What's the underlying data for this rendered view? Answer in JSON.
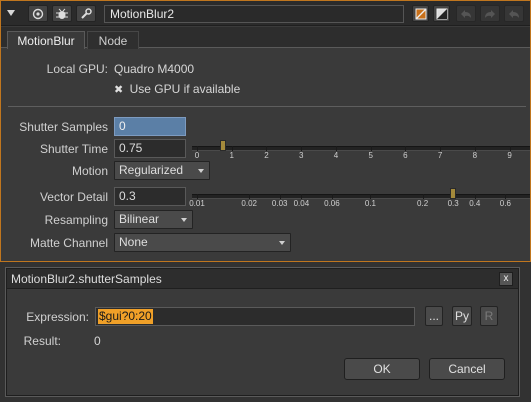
{
  "node": {
    "name": "MotionBlur2",
    "tabs": [
      {
        "label": "MotionBlur"
      },
      {
        "label": "Node"
      }
    ]
  },
  "properties": {
    "local_gpu_label": "Local GPU:",
    "local_gpu_value": "Quadro M4000",
    "use_gpu_checkbox": {
      "checked": true,
      "mark": "✖",
      "label": "Use GPU if available"
    },
    "shutter_samples": {
      "label": "Shutter Samples",
      "value": "0"
    },
    "shutter_time": {
      "label": "Shutter Time",
      "value": "0.75",
      "slider_ticks": [
        "0",
        "1",
        "2",
        "3",
        "4",
        "5",
        "6",
        "7",
        "8",
        "9"
      ],
      "slider_range": [
        0,
        9.5
      ]
    },
    "motion": {
      "label": "Motion",
      "value": "Regularized"
    },
    "vector_detail": {
      "label": "Vector Detail",
      "value": "0.3",
      "slider_ticks": [
        "0.01",
        "0.02",
        "0.03",
        "0.04",
        "0.06",
        "0.1",
        "0.2",
        "0.3",
        "0.4",
        "0.6"
      ],
      "slider_scale": "log",
      "slider_range": [
        0.01,
        0.8
      ]
    },
    "resampling": {
      "label": "Resampling",
      "value": "Bilinear"
    },
    "matte_channel": {
      "label": "Matte Channel",
      "value": "None"
    }
  },
  "dialog": {
    "title": "MotionBlur2.shutterSamples",
    "close_label": "x",
    "expression_label": "Expression:",
    "expression_value": "$gui?0:20",
    "browse_label": "...",
    "py_label": "Py",
    "r_label": "R",
    "result_label": "Result:",
    "result_value": "0",
    "ok_label": "OK",
    "cancel_label": "Cancel"
  },
  "colors": {
    "panel_border": "#c0761e",
    "selection_orange": "#f0a028",
    "focused_field": "#5b7fa6",
    "slider_handle": "#a48a3b"
  }
}
